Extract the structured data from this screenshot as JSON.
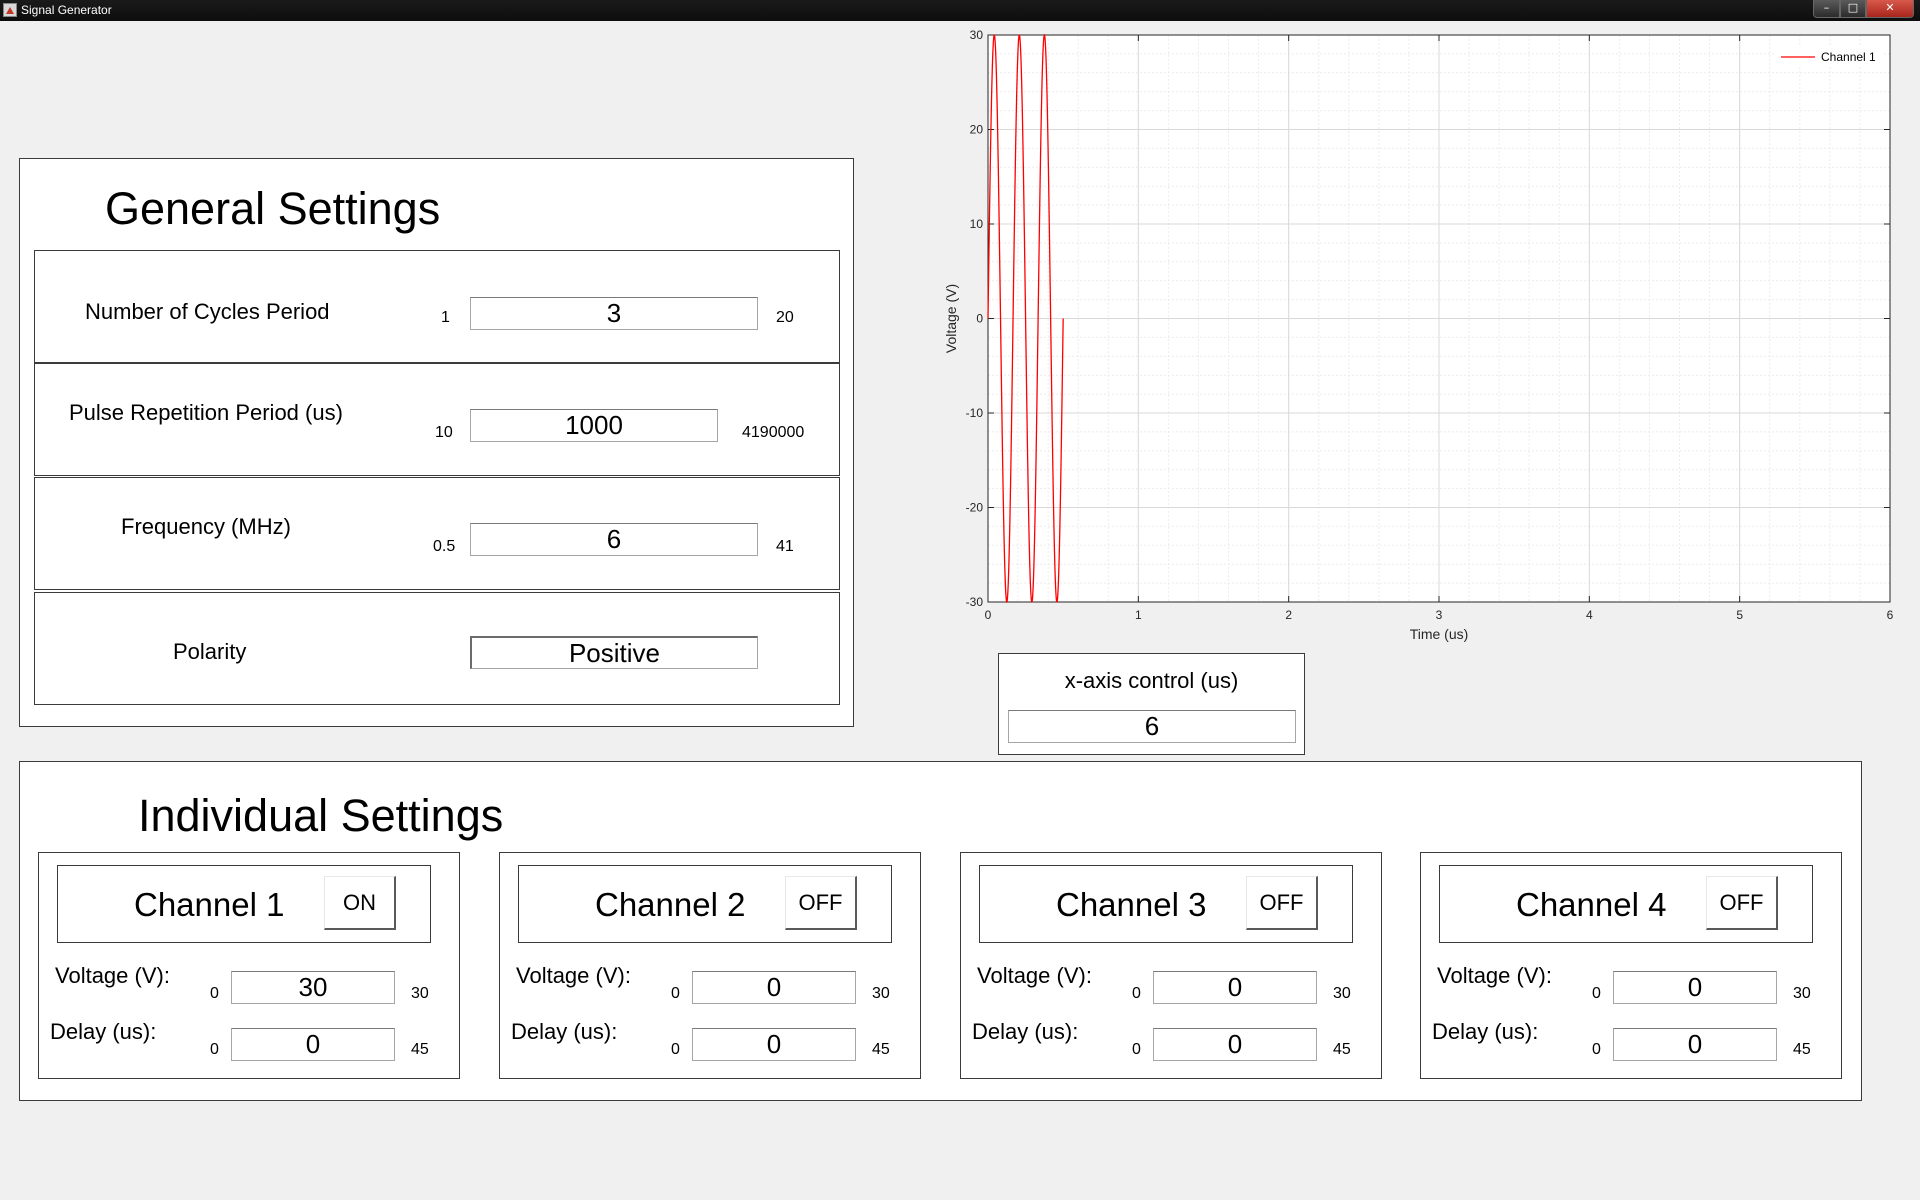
{
  "window": {
    "title": "Signal Generator"
  },
  "general": {
    "heading": "General Settings",
    "rows": [
      {
        "label": "Number of Cycles Period",
        "min": "1",
        "value": "3",
        "max": "20"
      },
      {
        "label": "Pulse Repetition Period (us)",
        "min": "10",
        "value": "1000",
        "max": "4190000"
      },
      {
        "label": "Frequency (MHz)",
        "min": "0.5",
        "value": "6",
        "max": "41"
      }
    ],
    "polarity": {
      "label": "Polarity",
      "value": "Positive"
    }
  },
  "xaxis_control": {
    "label": "x-axis control (us)",
    "value": "6"
  },
  "individual": {
    "heading": "Individual Settings",
    "channels": [
      {
        "name": "Channel 1",
        "state": "ON",
        "voltage_label": "Voltage (V):",
        "voltage_min": "0",
        "voltage": "30",
        "voltage_max": "30",
        "delay_label": "Delay (us):",
        "delay_min": "0",
        "delay": "0",
        "delay_max": "45"
      },
      {
        "name": "Channel 2",
        "state": "OFF",
        "voltage_label": "Voltage (V):",
        "voltage_min": "0",
        "voltage": "0",
        "voltage_max": "30",
        "delay_label": "Delay (us):",
        "delay_min": "0",
        "delay": "0",
        "delay_max": "45"
      },
      {
        "name": "Channel 3",
        "state": "OFF",
        "voltage_label": "Voltage (V):",
        "voltage_min": "0",
        "voltage": "0",
        "voltage_max": "30",
        "delay_label": "Delay (us):",
        "delay_min": "0",
        "delay": "0",
        "delay_max": "45"
      },
      {
        "name": "Channel 4",
        "state": "OFF",
        "voltage_label": "Voltage (V):",
        "voltage_min": "0",
        "voltage": "0",
        "voltage_max": "30",
        "delay_label": "Delay (us):",
        "delay_min": "0",
        "delay": "0",
        "delay_max": "45"
      }
    ]
  },
  "chart_data": {
    "type": "line",
    "xlabel": "Time (us)",
    "ylabel": "Voltage (V)",
    "xlim": [
      0,
      6
    ],
    "ylim": [
      -30,
      30
    ],
    "xticks": [
      "0",
      "1",
      "2",
      "3",
      "4",
      "5",
      "6"
    ],
    "yticks": [
      "30",
      "20",
      "10",
      "0",
      "-10",
      "-20",
      "-30"
    ],
    "grid": true,
    "minor_grid": true,
    "legend_position": "top-right",
    "series": [
      {
        "name": "Channel 1",
        "color": "#ff0000",
        "amplitude": 30,
        "frequency_mhz": 6,
        "cycles": 3,
        "x_start": 0,
        "x_end": 0.5
      }
    ]
  }
}
